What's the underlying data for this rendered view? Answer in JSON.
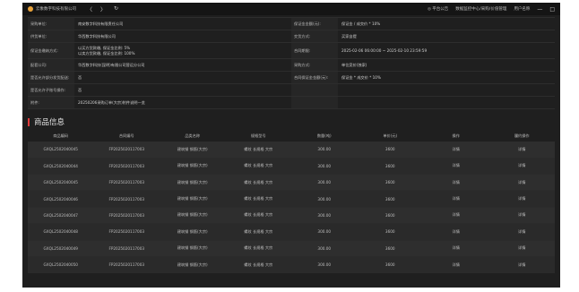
{
  "titlebar": {
    "app_name": "云象数字科技有限公司",
    "nav": [
      "〈",
      "〉",
      "↻"
    ],
    "right_items": [
      "◎ 平台公告",
      "数据监控中心/采购/价值管理",
      "用户名称"
    ],
    "window_buttons": [
      "—",
      "□"
    ]
  },
  "info_rows": [
    [
      {
        "label": "采购单位:",
        "value": [
          "南安数字科技有限责任公司"
        ]
      },
      {
        "label": "保证金金额(元):",
        "value": [
          "保证金 / 成交价 * 10%"
        ]
      }
    ],
    [
      {
        "label": "供货单位:",
        "value": [
          "华西数字科技有限公司"
        ]
      },
      {
        "label": "交货方式:",
        "value": [
          "买家自提"
        ]
      }
    ],
    [
      {
        "label": "保证金缴纳方式:",
        "value": [
          "以买方货款缴, 保证金比例: 5%",
          "以卖方货款缴, 保证金比例: 100%"
        ]
      },
      {
        "label": "合同期限:",
        "value": [
          "2025-02-06 06:00:00 ~ 2025-02-10 23:59:59"
        ]
      }
    ],
    [
      {
        "label": "配套公司:",
        "value": [
          "华西数字科技(昆明)有限公司营运分公司"
        ]
      },
      {
        "label": "采购方式:",
        "value": [
          "单位竞价(独家)"
        ]
      }
    ],
    [
      {
        "label": "是否允许部分发货配送:",
        "value": [
          "否"
        ]
      },
      {
        "label": "合同保证金金额(元):",
        "value": [
          "保证金 * 成交价 * 10%"
        ]
      }
    ],
    [
      {
        "label": "是否允许子账号操作:",
        "value": [
          "否"
        ]
      },
      {
        "label": "",
        "value": [
          ""
        ]
      }
    ],
    [
      {
        "label": "附件:",
        "value": [
          "20250206采购订单(大宗)附件说明一览"
        ]
      },
      {
        "label": "",
        "value": [
          ""
        ]
      }
    ]
  ],
  "goods": {
    "title": "商品信息",
    "columns": [
      "商品编码",
      "合同编号",
      "品类名称",
      "规格型号",
      "数量(吨)",
      "单价(元)",
      "操作",
      "履约操作"
    ],
    "rows": [
      [
        "GXQL2502040045",
        "FP2025020117003",
        "建筑钢 钢筋(大宗)",
        "螺纹 长规格 大宗",
        "300.00",
        "3600",
        "详情",
        "详情"
      ],
      [
        "GXQL2502040044",
        "FP2025020117003",
        "建筑钢 钢筋(大宗)",
        "螺纹 长规格 大宗",
        "300.00",
        "3600",
        "详情",
        "详情"
      ],
      [
        "GXQL2502040045",
        "FP2025020117003",
        "建筑钢 钢筋(大宗)",
        "螺纹 长规格 大宗",
        "300.00",
        "3600",
        "详情",
        "详情"
      ],
      [
        "GXQL2502040046",
        "FP2025020117003",
        "建筑钢 钢筋(大宗)",
        "螺纹 长规格 大宗",
        "300.00",
        "3600",
        "详情",
        "详情"
      ],
      [
        "GXQL2502040047",
        "FP2025020117003",
        "建筑钢 钢筋(大宗)",
        "螺纹 长规格 大宗",
        "300.00",
        "3600",
        "详情",
        "详情"
      ],
      [
        "GXQL2502040048",
        "FP2025020117003",
        "建筑钢 钢筋(大宗)",
        "螺纹 长规格 大宗",
        "300.00",
        "3600",
        "详情",
        "详情"
      ],
      [
        "GXQL2502040049",
        "FP2025020117003",
        "建筑钢 钢筋(大宗)",
        "螺纹 长规格 大宗",
        "300.00",
        "3600",
        "详情",
        "详情"
      ],
      [
        "GXQL2502040050",
        "FP2025020117003",
        "建筑钢 钢筋(大宗)",
        "螺纹 长规格 大宗",
        "300.00",
        "3600",
        "详情",
        "详情"
      ]
    ]
  },
  "colors": {
    "accent": "#e23c3c",
    "background": "#1f1f1f"
  }
}
